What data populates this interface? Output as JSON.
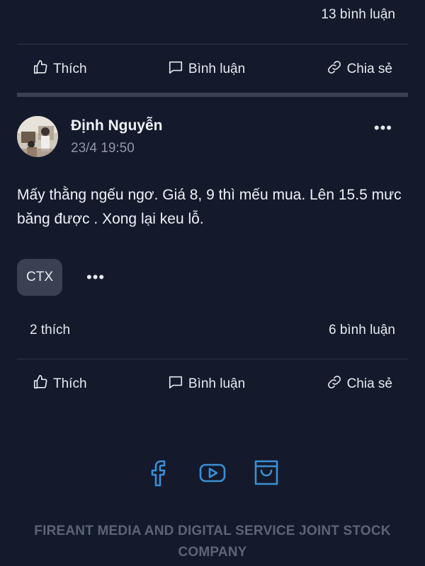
{
  "previous_post": {
    "comments": "13 bình luận",
    "actions": {
      "like": "Thích",
      "comment": "Bình luận",
      "share": "Chia sẻ"
    }
  },
  "post": {
    "author": "Định Nguyễn",
    "timestamp": "23/4 19:50",
    "more_icon": "more-horizontal-icon",
    "content": "Mấy thằng ngếu ngơ. Giá 8, 9 thì mếu mua. Lên 15.5 mưc băng được . Xong lại keu lỗ.",
    "tags": [
      "CTX"
    ],
    "likes": "2 thích",
    "comments": "6 bình luận",
    "actions": {
      "like": "Thích",
      "comment": "Bình luận",
      "share": "Chia sẻ"
    }
  },
  "footer": {
    "social": [
      "facebook-icon",
      "youtube-icon",
      "shopping-bag-icon"
    ],
    "company": "FIREANT MEDIA AND DIGITAL SERVICE JOINT STOCK COMPANY",
    "accent": "#3b8fd6"
  }
}
